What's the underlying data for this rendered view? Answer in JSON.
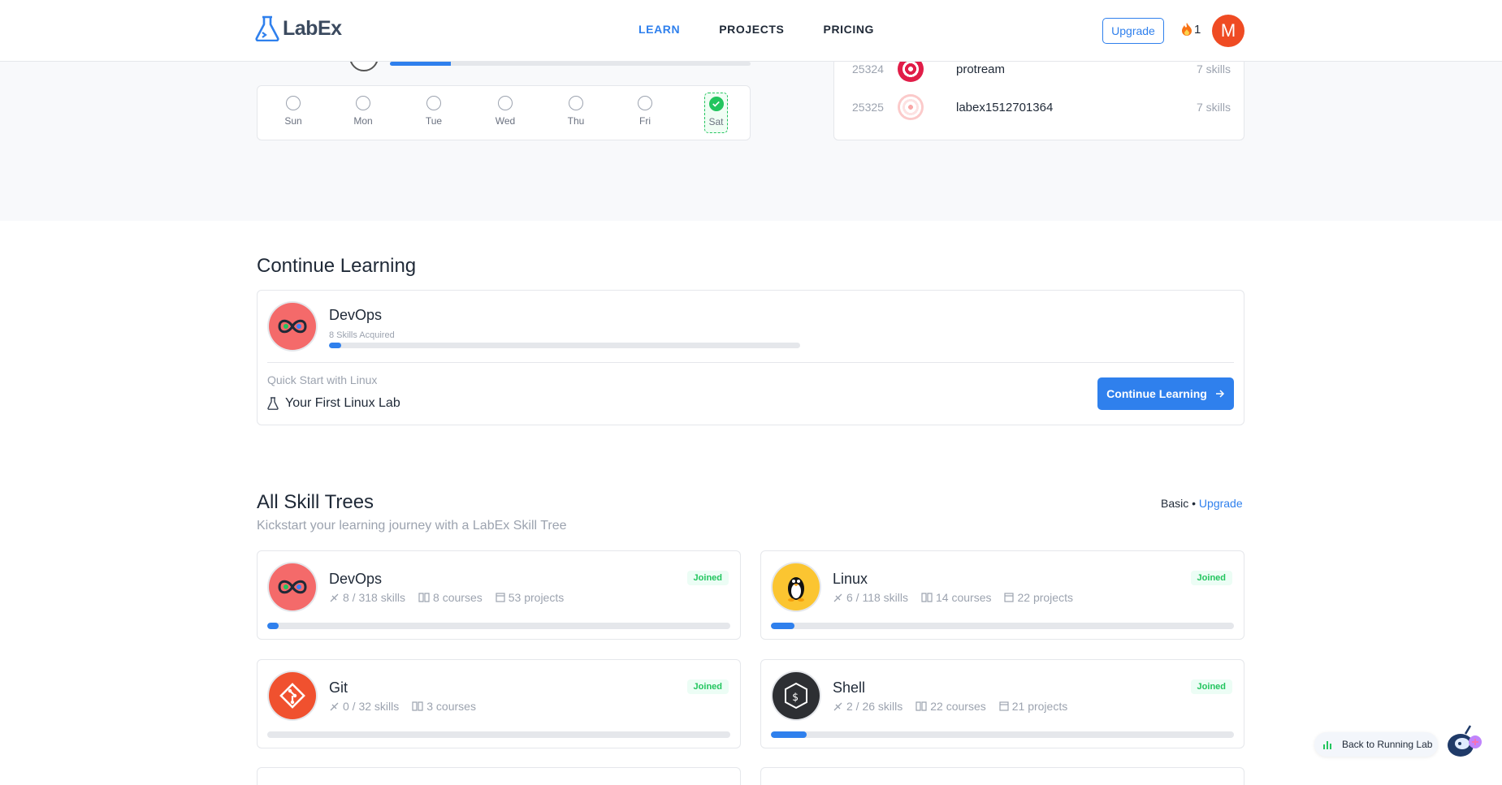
{
  "header": {
    "logo_lab": "Lab",
    "logo_ex": "Ex",
    "nav": [
      {
        "label": "LEARN",
        "active": true
      },
      {
        "label": "PROJECTS",
        "active": false
      },
      {
        "label": "PRICING",
        "active": false
      }
    ],
    "upgrade_label": "Upgrade",
    "streak_count": "1",
    "avatar_initial": "M"
  },
  "week": {
    "progress_fraction": 0.17,
    "days": [
      {
        "label": "Sun",
        "done": false
      },
      {
        "label": "Mon",
        "done": false
      },
      {
        "label": "Tue",
        "done": false
      },
      {
        "label": "Wed",
        "done": false
      },
      {
        "label": "Thu",
        "done": false
      },
      {
        "label": "Fri",
        "done": false
      },
      {
        "label": "Sat",
        "done": true
      }
    ]
  },
  "leaderboard": [
    {
      "rank": "25324",
      "name": "protream",
      "skills": "7 skills"
    },
    {
      "rank": "25325",
      "name": "labex1512701364",
      "skills": "7 skills"
    }
  ],
  "continue_learning": {
    "heading": "Continue Learning",
    "tree_name": "DevOps",
    "skills_acquired": "8 Skills Acquired",
    "progress_fraction": 0.025,
    "course": "Quick Start with Linux",
    "lab": "Your First Linux Lab",
    "button_label": "Continue Learning"
  },
  "skill_trees": {
    "heading": "All Skill Trees",
    "subtitle": "Kickstart your learning journey with a LabEx Skill Tree",
    "plan_label": "Basic",
    "plan_sep": " • ",
    "plan_upgrade": "Upgrade",
    "trees": [
      {
        "name": "DevOps",
        "skills": "8 / 318 skills",
        "courses": "8 courses",
        "projects": "53 projects",
        "badge": "Joined",
        "progress_fraction": 0.025
      },
      {
        "name": "Linux",
        "skills": "6 / 118 skills",
        "courses": "14 courses",
        "projects": "22 projects",
        "badge": "Joined",
        "progress_fraction": 0.051
      },
      {
        "name": "Git",
        "skills": "0 / 32 skills",
        "courses": "3 courses",
        "projects": "",
        "badge": "Joined",
        "progress_fraction": 0
      },
      {
        "name": "Shell",
        "skills": "2 / 26 skills",
        "courses": "22 courses",
        "projects": "21 projects",
        "badge": "Joined",
        "progress_fraction": 0.077
      }
    ]
  },
  "floating": {
    "back_label": "Back to Running Lab"
  },
  "colors": {
    "accent": "#2f80ed",
    "success": "#22c55e",
    "avatar": "#ef4b23"
  }
}
